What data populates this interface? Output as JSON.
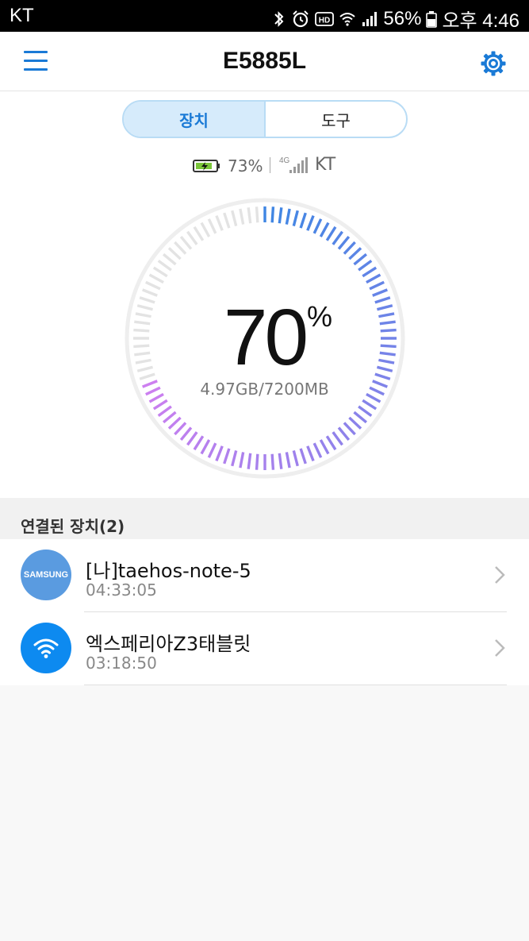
{
  "status_bar": {
    "carrier": "KT",
    "battery_percent": "56%",
    "time": "오후 4:46",
    "icons": [
      "bluetooth-icon",
      "alarm-icon",
      "hd-icon",
      "wifi-icon",
      "signal-icon",
      "battery-icon"
    ]
  },
  "app_bar": {
    "title": "E5885L",
    "menu_icon": "hamburger-menu-icon",
    "settings_icon": "gear-icon",
    "accent_color": "#1a7ad6"
  },
  "tabs": [
    {
      "label": "장치",
      "active": true
    },
    {
      "label": "도구",
      "active": false
    }
  ],
  "device_status": {
    "battery_percent": "73%",
    "network_type": "4G",
    "carrier": "KT"
  },
  "data_usage": {
    "percent": "70",
    "percent_sign": "%",
    "detail": "4.97GB/7200MB",
    "fraction": 0.7,
    "gradient_colors": [
      "#3f86e3",
      "#cf7ff0"
    ]
  },
  "connected": {
    "header": "연결된 장치(2)",
    "devices": [
      {
        "name": "[나]taehos-note-5",
        "time": "04:33:05",
        "avatar": "SAMSUNG"
      },
      {
        "name": "엑스페리아Z3태블릿",
        "time": "03:18:50",
        "avatar": "wifi-icon"
      }
    ]
  }
}
